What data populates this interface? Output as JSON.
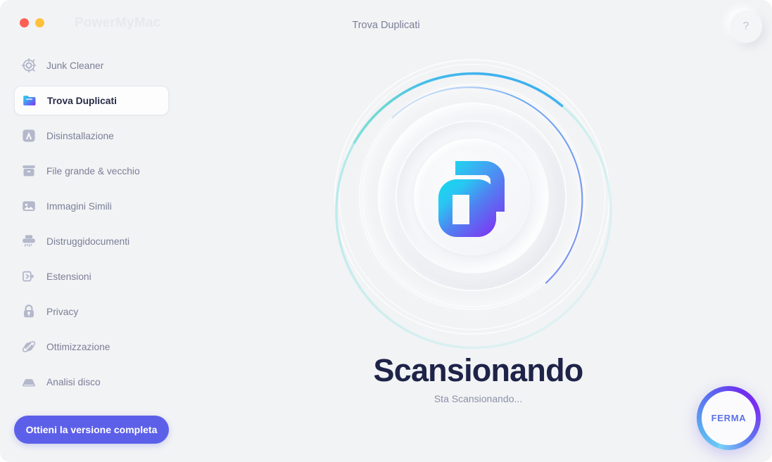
{
  "window": {
    "brand": "PowerMyMac",
    "title": "Trova Duplicati",
    "help_label": "?",
    "traffic_lights": [
      {
        "name": "close",
        "color": "#ff5e55"
      },
      {
        "name": "minimize",
        "color": "#ffc13c"
      }
    ]
  },
  "sidebar": {
    "items": [
      {
        "label": "Junk Cleaner",
        "icon": "junk-cleaner-icon",
        "active": false
      },
      {
        "label": "Trova Duplicati",
        "icon": "folder-icon",
        "active": true
      },
      {
        "label": "Disinstallazione",
        "icon": "app-store-icon",
        "active": false
      },
      {
        "label": "File grande & vecchio",
        "icon": "archive-box-icon",
        "active": false
      },
      {
        "label": "Immagini Simili",
        "icon": "image-icon",
        "active": false
      },
      {
        "label": "Distruggidocumenti",
        "icon": "shredder-icon",
        "active": false
      },
      {
        "label": "Estensioni",
        "icon": "plug-icon",
        "active": false
      },
      {
        "label": "Privacy",
        "icon": "lock-icon",
        "active": false
      },
      {
        "label": "Ottimizzazione",
        "icon": "optimize-icon",
        "active": false
      },
      {
        "label": "Analisi disco",
        "icon": "disk-icon",
        "active": false
      }
    ],
    "cta_label": "Ottieni la versione completa",
    "cta_color": "#5c60e8"
  },
  "main": {
    "scan_title": "Scansionando",
    "scan_subtitle": "Sta Scansionando...",
    "center_icon": "duplicate-files-icon",
    "title_color": "#1e2348",
    "subtitle_color": "#8b90a6",
    "outer_arc_colors": [
      "#6fd8d2",
      "#3fb8ea",
      "#49a6ee"
    ],
    "inner_arc_colors": [
      "#9ecbf7",
      "#5b8cf0",
      "#7b8ff2"
    ]
  },
  "stop_button": {
    "label": "FERMA",
    "text_color": "#5c72e8",
    "ring_gradient_from": "#6bc8f5",
    "ring_gradient_to": "#7b2ff2"
  }
}
